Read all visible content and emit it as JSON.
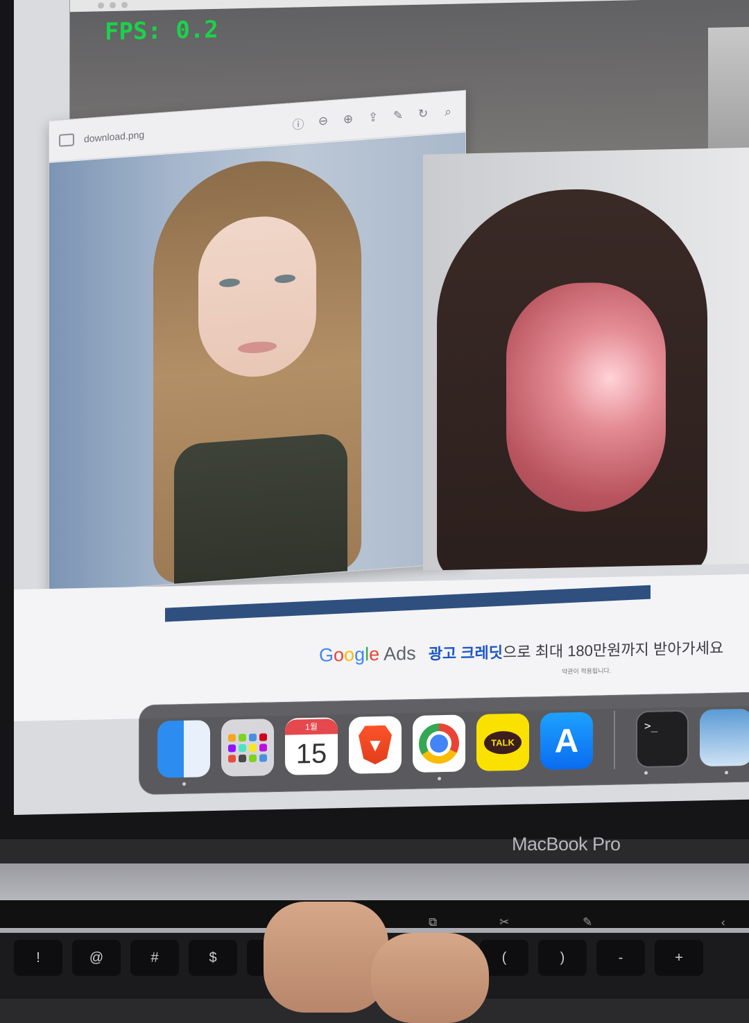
{
  "camera_window": {
    "fps_label": "FPS: 0.2"
  },
  "preview_window": {
    "filename": "download.png",
    "toolbar_icons": [
      "sidebar-icon",
      "info-icon",
      "zoom-out-icon",
      "zoom-in-icon",
      "share-icon",
      "markup-icon",
      "rotate-icon",
      "search-icon"
    ]
  },
  "webpage": {
    "progress": 1.0,
    "ads_logo": [
      "G",
      "o",
      "o",
      "g",
      "l",
      "e",
      " Ads"
    ],
    "ads_highlight": "광고 크레딧",
    "ads_text": "으로 최대 180만원까지 받아가세요",
    "fine_print": "약관이 적용됩니다."
  },
  "dock": {
    "apps": [
      {
        "name": "Finder",
        "icon": "finder-icon"
      },
      {
        "name": "Launchpad",
        "icon": "launchpad-icon"
      },
      {
        "name": "Calendar",
        "icon": "calendar-icon",
        "month": "1월",
        "day": "15"
      },
      {
        "name": "Brave",
        "icon": "brave-icon"
      },
      {
        "name": "Chrome",
        "icon": "chrome-icon"
      },
      {
        "name": "KakaoTalk",
        "icon": "kakaotalk-icon",
        "label": "TALK"
      },
      {
        "name": "App Store",
        "icon": "app-store-icon",
        "glyph": "A"
      },
      {
        "name": "Terminal",
        "icon": "terminal-icon",
        "glyph": ">_"
      },
      {
        "name": "Preview",
        "icon": "preview-icon"
      }
    ]
  },
  "laptop": {
    "brand": "MacBook Pro",
    "keys": [
      "!",
      "@",
      "#",
      "$",
      "%",
      "^",
      "&",
      "*",
      "(",
      ")",
      "-",
      "+"
    ]
  },
  "colors": {
    "fps_green": "#19d34a",
    "progress_blue": "#2f4f7f",
    "ads_link_blue": "#1a56c7"
  }
}
